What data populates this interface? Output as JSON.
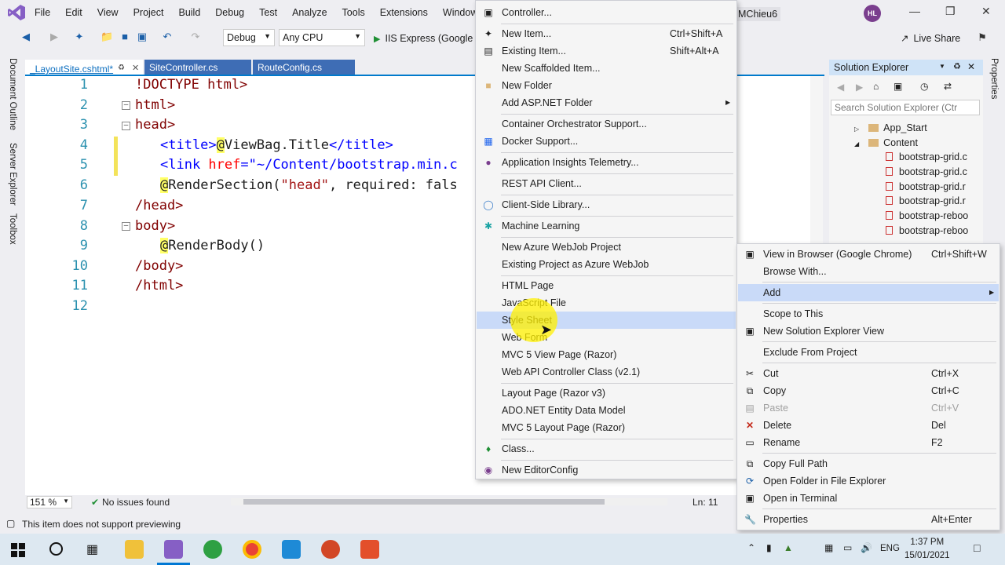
{
  "menu": [
    "File",
    "Edit",
    "View",
    "Project",
    "Build",
    "Debug",
    "Test",
    "Analyze",
    "Tools",
    "Extensions",
    "Window"
  ],
  "solution_name": "MChieu6",
  "user_initials": "HL",
  "toolbar": {
    "config": "Debug",
    "platform": "Any CPU",
    "run_target": "IIS Express (Google C",
    "live_share": "Live Share"
  },
  "left_tools": [
    "Document Outline",
    "Server Explorer",
    "Toolbox"
  ],
  "right_tools": [
    "Properties"
  ],
  "tabs": [
    {
      "label": "_LayoutSite.cshtml*",
      "active": true
    },
    {
      "label": "SiteController.cs",
      "active": false
    },
    {
      "label": "RouteConfig.cs",
      "active": false
    }
  ],
  "code": {
    "line_numbers": [
      "1",
      "2",
      "3",
      "4",
      "5",
      "6",
      "7",
      "8",
      "9",
      "10",
      "11",
      "12"
    ],
    "l1": "!DOCTYPE html>",
    "l2": "html>",
    "l3": "head>",
    "l4_a": "<title>",
    "l4_b": "@",
    "l4_c": "ViewBag.Title",
    "l4_d": "</title>",
    "l5_a": "<link ",
    "l5_b": "href",
    "l5_c": "=\"~/Content/bootstrap.min.c",
    "l6_a": "@",
    "l6_b": "RenderSection(",
    "l6_c": "\"head\"",
    "l6_d": ", required: fals",
    "l7": "/head>",
    "l8": "body>",
    "l9_a": "@",
    "l9_b": "RenderBody()",
    "l10": "/body>",
    "l11": "/html>"
  },
  "editor_status": {
    "zoom": "151 %",
    "issues": "No issues found",
    "line": "Ln: 11"
  },
  "status_message": "This item does not support previewing",
  "solution_explorer": {
    "title": "Solution Explorer",
    "search_placeholder": "Search Solution Explorer (Ctr",
    "items": [
      {
        "label": "App_Start",
        "type": "folder"
      },
      {
        "label": "Content",
        "type": "folder"
      },
      {
        "label": "bootstrap-grid.c",
        "type": "file"
      },
      {
        "label": "bootstrap-grid.c",
        "type": "file"
      },
      {
        "label": "bootstrap-grid.r",
        "type": "file"
      },
      {
        "label": "bootstrap-grid.r",
        "type": "file"
      },
      {
        "label": "bootstrap-reboo",
        "type": "file"
      },
      {
        "label": "bootstrap-reboo",
        "type": "file"
      }
    ]
  },
  "add_menu": [
    {
      "label": "Controller...",
      "shortcut": ""
    },
    {
      "label": "New Item...",
      "shortcut": "Ctrl+Shift+A"
    },
    {
      "label": "Existing Item...",
      "shortcut": "Shift+Alt+A"
    },
    {
      "label": "New Scaffolded Item...",
      "shortcut": ""
    },
    {
      "label": "New Folder",
      "shortcut": ""
    },
    {
      "label": "Add ASP.NET Folder",
      "shortcut": ""
    },
    {
      "label": "Container Orchestrator Support...",
      "shortcut": ""
    },
    {
      "label": "Docker Support...",
      "shortcut": ""
    },
    {
      "label": "Application Insights Telemetry...",
      "shortcut": ""
    },
    {
      "label": "REST API Client...",
      "shortcut": ""
    },
    {
      "label": "Client-Side Library...",
      "shortcut": ""
    },
    {
      "label": "Machine Learning",
      "shortcut": ""
    },
    {
      "label": "New Azure WebJob Project",
      "shortcut": ""
    },
    {
      "label": "Existing Project as Azure WebJob",
      "shortcut": ""
    },
    {
      "label": "HTML Page",
      "shortcut": ""
    },
    {
      "label": "JavaScript File",
      "shortcut": ""
    },
    {
      "label": "Style Sheet",
      "shortcut": ""
    },
    {
      "label": "Web Form",
      "shortcut": ""
    },
    {
      "label": "MVC 5 View Page (Razor)",
      "shortcut": ""
    },
    {
      "label": "Web API Controller Class (v2.1)",
      "shortcut": ""
    },
    {
      "label": "Layout Page (Razor v3)",
      "shortcut": ""
    },
    {
      "label": "ADO.NET Entity Data Model",
      "shortcut": ""
    },
    {
      "label": "MVC 5 Layout Page (Razor)",
      "shortcut": ""
    },
    {
      "label": "Class...",
      "shortcut": ""
    },
    {
      "label": "New EditorConfig",
      "shortcut": ""
    }
  ],
  "context_menu": [
    {
      "label": "View in Browser (Google Chrome)",
      "shortcut": "Ctrl+Shift+W"
    },
    {
      "label": "Browse With...",
      "shortcut": ""
    },
    {
      "label": "Add",
      "shortcut": ""
    },
    {
      "label": "Scope to This",
      "shortcut": ""
    },
    {
      "label": "New Solution Explorer View",
      "shortcut": ""
    },
    {
      "label": "Exclude From Project",
      "shortcut": ""
    },
    {
      "label": "Cut",
      "shortcut": "Ctrl+X"
    },
    {
      "label": "Copy",
      "shortcut": "Ctrl+C"
    },
    {
      "label": "Paste",
      "shortcut": "Ctrl+V"
    },
    {
      "label": "Delete",
      "shortcut": "Del"
    },
    {
      "label": "Rename",
      "shortcut": "F2"
    },
    {
      "label": "Copy Full Path",
      "shortcut": ""
    },
    {
      "label": "Open Folder in File Explorer",
      "shortcut": ""
    },
    {
      "label": "Open in Terminal",
      "shortcut": ""
    },
    {
      "label": "Properties",
      "shortcut": "Alt+Enter"
    }
  ],
  "taskbar": {
    "lang": "ENG",
    "time": "1:37 PM",
    "date": "15/01/2021"
  },
  "colors": {
    "accent": "#007acc",
    "menu_highlight": "#c9daf8",
    "tag": "#800000",
    "attr": "#ff0000",
    "string": "#0000ff",
    "line_number": "#2b91af"
  }
}
